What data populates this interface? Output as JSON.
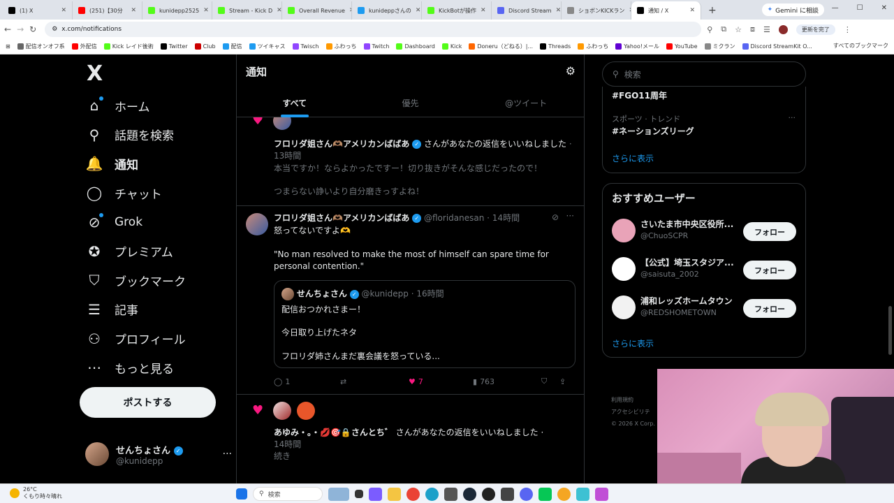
{
  "browser": {
    "tabs": [
      {
        "label": "(1) X",
        "color": "#000000"
      },
      {
        "label": "(251)【30分",
        "color": "#ff0000"
      },
      {
        "label": "kunidepp2525",
        "color": "#53fc18"
      },
      {
        "label": "Stream - Kick D",
        "color": "#53fc18"
      },
      {
        "label": "Overall Revenue",
        "color": "#53fc18"
      },
      {
        "label": "kunideppさんの",
        "color": "#1d9bf0"
      },
      {
        "label": "KickBotが操作",
        "color": "#53fc18"
      },
      {
        "label": "Discord Stream",
        "color": "#5865f2"
      },
      {
        "label": "ショボンKICKラン",
        "color": "#888888"
      },
      {
        "label": "通知 / X",
        "color": "#000000"
      }
    ],
    "new_tab": "+",
    "gemini_label": "Gemini に相談",
    "url": "x.com/notifications",
    "update_label": "更新を完了",
    "bookmarks": [
      {
        "label": "配信オンオフ系",
        "color": "#666666"
      },
      {
        "label": "外配信",
        "color": "#ff0000"
      },
      {
        "label": "Kick レイド後術",
        "color": "#53fc18"
      },
      {
        "label": "Twitter",
        "color": "#000000"
      },
      {
        "label": "Club",
        "color": "#cc0000"
      },
      {
        "label": "配信",
        "color": "#1d9bf0"
      },
      {
        "label": "ツイキャス",
        "color": "#1d9bf0"
      },
      {
        "label": "Twisch",
        "color": "#9146ff"
      },
      {
        "label": "ふわっち",
        "color": "#ff9900"
      },
      {
        "label": "Twitch",
        "color": "#9146ff"
      },
      {
        "label": "Dashboard",
        "color": "#53fc18"
      },
      {
        "label": "Kick",
        "color": "#53fc18"
      },
      {
        "label": "Doneru（どねる）|...",
        "color": "#ff6600"
      },
      {
        "label": "Threads",
        "color": "#000000"
      },
      {
        "label": "ふわっち",
        "color": "#ff9900"
      },
      {
        "label": "Yahoo!メール",
        "color": "#6001d2"
      },
      {
        "label": "YouTube",
        "color": "#ff0000"
      },
      {
        "label": "ミクラン",
        "color": "#888888"
      },
      {
        "label": "Discord StreamKit O...",
        "color": "#5865f2"
      }
    ],
    "all_bookmarks": "すべてのブックマーク"
  },
  "sidebar": {
    "logo": "X",
    "items": [
      {
        "label": "ホーム",
        "icon": "home-icon",
        "glyph": "⌂",
        "dot": true
      },
      {
        "label": "話題を検索",
        "icon": "search-icon",
        "glyph": "⚲",
        "dot": false
      },
      {
        "label": "通知",
        "icon": "bell-icon",
        "glyph": "🔔",
        "dot": false
      },
      {
        "label": "チャット",
        "icon": "chat-icon",
        "glyph": "◯",
        "dot": false
      },
      {
        "label": "Grok",
        "icon": "grok-icon",
        "glyph": "⊘",
        "dot": true
      },
      {
        "label": "プレミアム",
        "icon": "premium-icon",
        "glyph": "✪",
        "dot": false
      },
      {
        "label": "ブックマーク",
        "icon": "bookmark-icon",
        "glyph": "⛉",
        "dot": false
      },
      {
        "label": "記事",
        "icon": "article-icon",
        "glyph": "☰",
        "dot": false
      },
      {
        "label": "プロフィール",
        "icon": "profile-icon",
        "glyph": "⚇",
        "dot": false
      },
      {
        "label": "もっと見る",
        "icon": "more-icon",
        "glyph": "⋯",
        "dot": false
      }
    ],
    "post_button": "ポストする",
    "account_name": "せんちょさん",
    "account_handle": "@kunidepp",
    "account_more": "···"
  },
  "main": {
    "title": "通知",
    "tabs": [
      "すべて",
      "優先",
      "@ツイート"
    ],
    "notif1": {
      "actor": "フロリダ姐さん🫶🏽アメリカンばばあ",
      "action": "さんがあなたの返信をいいねしました",
      "time": "· 13時間",
      "line1": "本当ですか！ならよかったですー！切り抜きがそんな感じだったので！",
      "line2": "つまらない諍いより自分磨きっすよね！"
    },
    "post": {
      "name": "フロリダ姐さん🫶🏽アメリカンばばあ",
      "handle": "@floridanesan",
      "time": "· 14時間",
      "text1": "怒ってないですよ🫶",
      "text2": "\"No man resolved to make the most of himself can spare time for personal contention.\"",
      "quote_name": "せんちょさん",
      "quote_handle": "@kunidepp",
      "quote_time": "· 16時間",
      "quote_l1": "配信おつかれさまー！",
      "quote_l2": "今日取り上げたネタ",
      "quote_l3": "フロリダ姉さんまだ裏会議を怒っている...",
      "replies": "1",
      "likes": "7",
      "views": "763"
    },
    "notif2": {
      "actors": "あゆみ・。・💋🎯🔒さんとち゛",
      "action": "さんがあなたの返信をいいねしました ·",
      "time": "14時間",
      "text": "続き"
    }
  },
  "right": {
    "search_placeholder": "検索",
    "trend1_name": "#FGO11周年",
    "trend2_cat": "スポーツ · トレンド",
    "trend2_name": "#ネーションズリーグ",
    "trend_more": "···",
    "show_more": "さらに表示",
    "who_title": "おすすめユーザー",
    "users": [
      {
        "name": "さいたま市中央区役所...",
        "handle": "@ChuoSCPR",
        "color": "#e9a3b8"
      },
      {
        "name": "【公式】埼玉スタジア...",
        "handle": "@saisuta_2002",
        "color": "#ffffff"
      },
      {
        "name": "浦和レッズホームタウン",
        "handle": "@REDSHOMETOWN",
        "color": "#f2f2f2"
      }
    ],
    "follow_label": "フォロー",
    "show_more2": "さらに表示",
    "footer1": "利用規約",
    "footer2": "アクセシビリテ",
    "footer3": "© 2026 X Corp."
  },
  "taskbar": {
    "temp": "26°C",
    "weather": "くもり時々晴れ",
    "search": "検索"
  }
}
